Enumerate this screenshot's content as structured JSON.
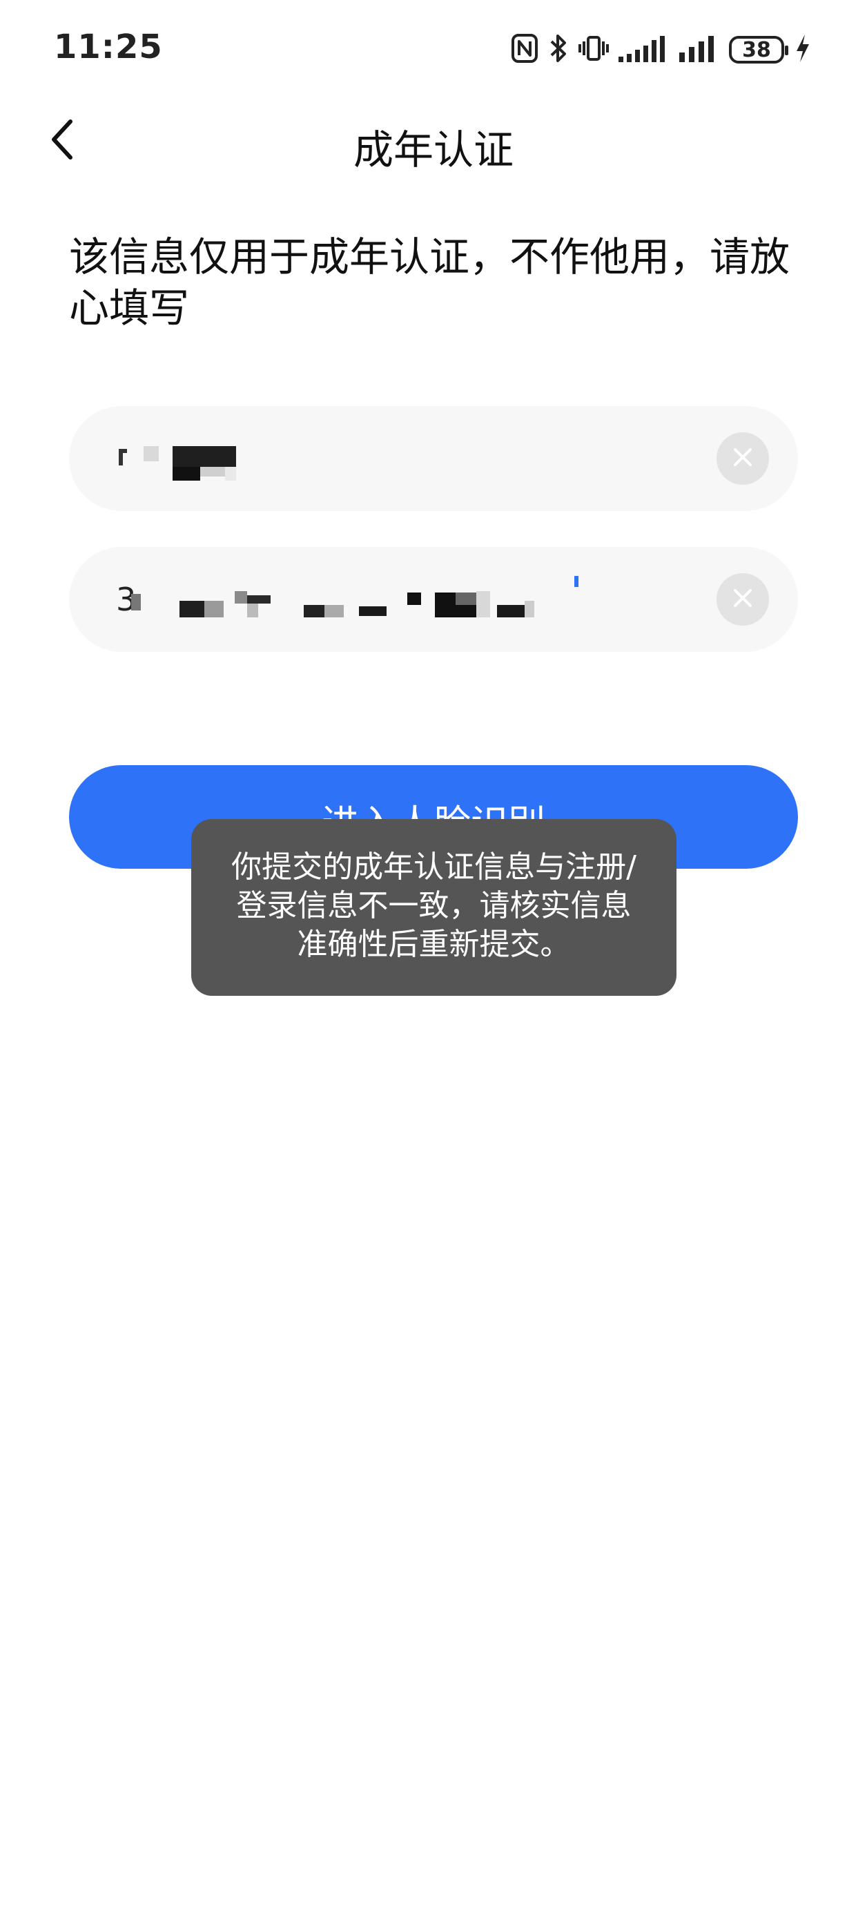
{
  "status_bar": {
    "time": "11:25",
    "battery_level": "38",
    "icons": [
      "nfc-icon",
      "bluetooth-icon",
      "vibrate-icon",
      "signal-1-icon",
      "signal-2-icon",
      "battery-icon",
      "charging-icon"
    ]
  },
  "header": {
    "back_icon": "chevron-left-icon",
    "title": "成年认证"
  },
  "notice": "该信息仅用于成年认证，不作他用，请放心填写",
  "form": {
    "name_field": {
      "clear_icon": "close-icon"
    },
    "id_field": {
      "visible_prefix": "3",
      "clear_icon": "close-icon"
    }
  },
  "primary_button": {
    "label": "进入人脸识别"
  },
  "toast": {
    "message": "你提交的成年认证信息与注册/登录信息不一致，请核实信息准确性后重新提交。"
  },
  "colors": {
    "accent": "#2e72f8",
    "toast_bg": "#555555",
    "field_bg": "#f7f7f7"
  }
}
